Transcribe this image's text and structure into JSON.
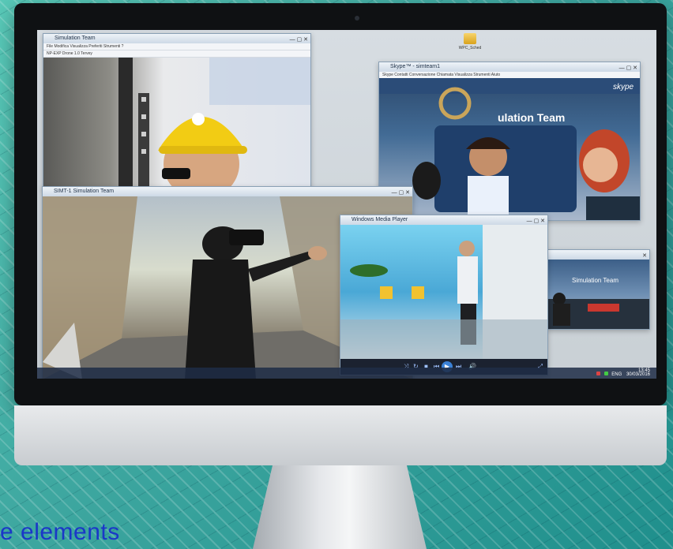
{
  "monitor": {
    "caption": "e elements"
  },
  "desktop": {
    "folder_label": "WPC_Sched"
  },
  "windows": {
    "top_left": {
      "title": "Simulation Team",
      "menu": "File  Modifica  Visualizza  Preferiti  Strumenti  ?",
      "subtitle": "NP-EXP Drone 1.0 Tervey"
    },
    "skype": {
      "title": "Skype™ - simteam1",
      "menu": "Skype  Contatti  Conversazione  Chiamata  Visualizza  Strumenti  Aiuto",
      "banner": "ulation Team",
      "logo": "skype"
    },
    "vr": {
      "title": "SIMT-1 Simulation Team"
    },
    "media_player": {
      "title": "Windows Media Player"
    },
    "small_right": {
      "banner": "Simulation Team"
    }
  },
  "taskbar": {
    "tray_time": "13:45",
    "tray_date": "30/03/2016",
    "tray_lang": "ENG"
  }
}
